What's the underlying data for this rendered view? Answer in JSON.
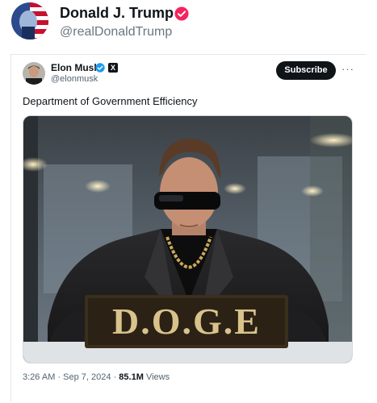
{
  "outer": {
    "name": "Donald J. Trump",
    "handle": "@realDonaldTrump",
    "verified_color": "#f4245e"
  },
  "tweet": {
    "author_name": "Elon Musk",
    "author_handle": "@elonmusk",
    "subscribe_label": "Subscribe",
    "more_label": "···",
    "x_logo": "X",
    "text": "Department of Government Efficiency",
    "sign_text": "D.O.G.E",
    "time": "3:26 AM",
    "date": "Sep 7, 2024",
    "separator": "·",
    "views_count": "85.1M",
    "views_label": "Views",
    "verified_color": "#1d9bf0"
  }
}
